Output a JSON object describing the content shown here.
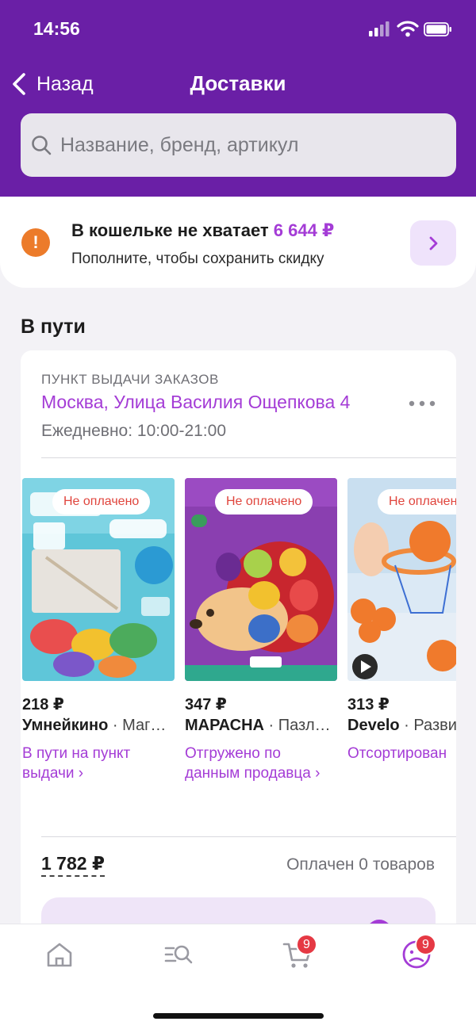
{
  "status_bar": {
    "time": "14:56"
  },
  "nav": {
    "back_label": "Назад",
    "title": "Доставки"
  },
  "search": {
    "placeholder": "Название, бренд, артикул"
  },
  "wallet": {
    "title": "В кошельке не хватает",
    "amount": "6 644 ₽",
    "subtitle": "Пополните, чтобы сохранить скидку"
  },
  "section": {
    "title": "В пути"
  },
  "pickup": {
    "label": "ПУНКТ ВЫДАЧИ ЗАКАЗОВ",
    "address": "Москва, Улица Василия Ощепкова 4",
    "hours": "Ежедневно: 10:00-21:00"
  },
  "products": [
    {
      "badge": "Не оплачено",
      "price": "218 ₽",
      "brand": "Умнейкино",
      "category": " · Маг…",
      "status": "В пути на пункт выдачи ›"
    },
    {
      "badge": "Не оплачено",
      "price": "347 ₽",
      "brand": "МАРАСНА",
      "category": " · Пазл…",
      "status": "Отгружено по данным продавца ›"
    },
    {
      "badge": "Не оплачено",
      "price": "313 ₽",
      "brand": "Develo",
      "category": " · Разви",
      "status": "Отсортирован"
    }
  ],
  "summary": {
    "total": "1 782 ₽",
    "paid_count": "Оплачен 0 товаров"
  },
  "tabbar": {
    "cart_badge": "9",
    "profile_badge": "9"
  },
  "colors": {
    "header": "#6a1fa6",
    "accent": "#a43cd6",
    "warning": "#ec7b2a",
    "error": "#e0453d",
    "badge": "#e53944"
  },
  "icons": [
    "chevron-left-icon",
    "search-icon",
    "alert-icon",
    "chevron-right-icon",
    "more-icon",
    "home-icon",
    "catalog-search-icon",
    "cart-icon",
    "profile-icon"
  ]
}
